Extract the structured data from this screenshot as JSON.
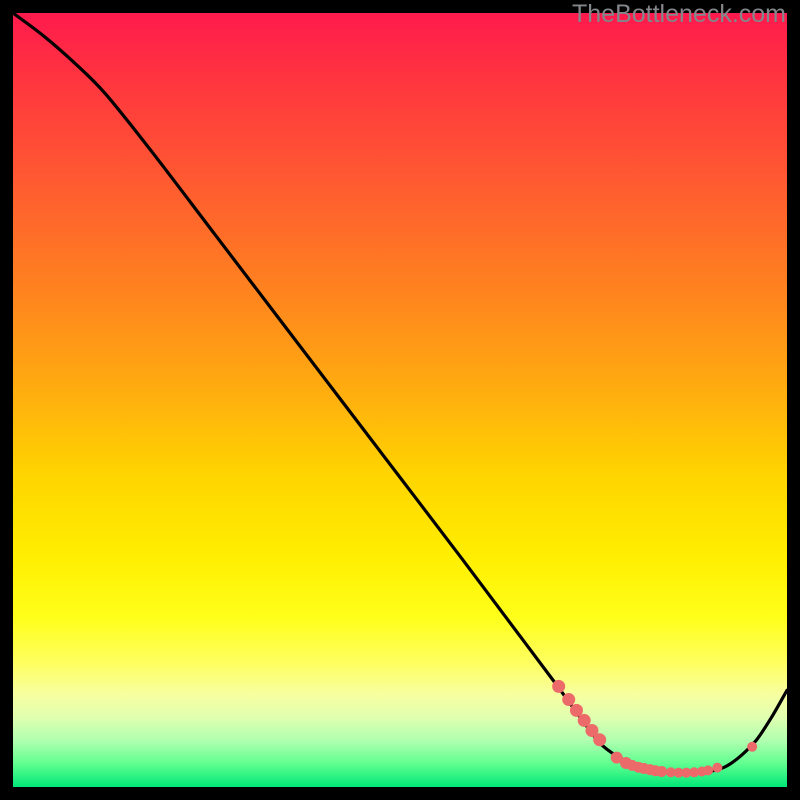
{
  "watermark": "TheBottleneck.com",
  "colors": {
    "curve": "#000000",
    "dot_fill": "#ec6a6a",
    "dot_stroke": "#c94f4f"
  },
  "chart_data": {
    "type": "line",
    "title": "",
    "xlabel": "",
    "ylabel": "",
    "xlim": [
      0,
      100
    ],
    "ylim": [
      0,
      100
    ],
    "series": [
      {
        "name": "bottleneck-curve",
        "x": [
          0,
          4,
          8,
          12,
          18,
          26,
          34,
          42,
          50,
          58,
          64,
          70,
          74,
          76,
          78,
          80,
          82,
          84,
          86,
          88,
          90,
          92,
          94,
          96,
          98,
          100
        ],
        "y": [
          100,
          97,
          93.5,
          89.5,
          82,
          71.5,
          61,
          50.5,
          40,
          29.5,
          21.5,
          13.5,
          8,
          5.5,
          4,
          3,
          2.4,
          2,
          1.8,
          1.8,
          2,
          2.6,
          4,
          6,
          9,
          12.5
        ]
      }
    ],
    "markers": [
      {
        "x": 70.5,
        "y": 13.0
      },
      {
        "x": 71.8,
        "y": 11.3
      },
      {
        "x": 72.8,
        "y": 9.9
      },
      {
        "x": 73.8,
        "y": 8.6
      },
      {
        "x": 74.8,
        "y": 7.3
      },
      {
        "x": 75.8,
        "y": 6.1
      },
      {
        "x": 78.0,
        "y": 3.8
      },
      {
        "x": 79.2,
        "y": 3.1
      },
      {
        "x": 80.0,
        "y": 2.8
      },
      {
        "x": 80.8,
        "y": 2.55
      },
      {
        "x": 81.5,
        "y": 2.4
      },
      {
        "x": 82.3,
        "y": 2.25
      },
      {
        "x": 83.0,
        "y": 2.1
      },
      {
        "x": 83.8,
        "y": 2.0
      },
      {
        "x": 85.0,
        "y": 1.9
      },
      {
        "x": 86.0,
        "y": 1.85
      },
      {
        "x": 87.0,
        "y": 1.85
      },
      {
        "x": 88.0,
        "y": 1.9
      },
      {
        "x": 89.0,
        "y": 2.0
      },
      {
        "x": 89.8,
        "y": 2.15
      },
      {
        "x": 91.0,
        "y": 2.5
      },
      {
        "x": 95.5,
        "y": 5.2
      }
    ],
    "marker_radii": [
      6.5,
      6.5,
      6.5,
      6.5,
      6.5,
      6.5,
      6,
      6,
      5.5,
      5.5,
      5.5,
      5.5,
      5.5,
      5.5,
      5,
      5,
      5,
      5,
      5,
      5,
      5,
      5
    ]
  }
}
